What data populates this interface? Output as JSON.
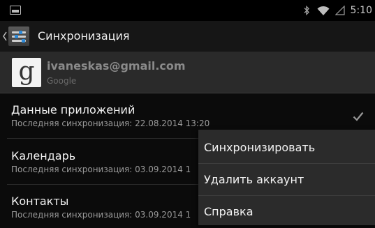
{
  "status_bar": {
    "time": "5:10",
    "icons": [
      "image-icon",
      "bluetooth-icon",
      "wifi-icon",
      "signal-icon"
    ]
  },
  "action_bar": {
    "title": "Синхронизация",
    "icons": [
      "back-caret-icon",
      "settings-sync-icon"
    ]
  },
  "account": {
    "logo_letter": "g",
    "email": "ivaneskas@gmail.com",
    "provider": "Google"
  },
  "sync_items": [
    {
      "title": "Данные приложений",
      "subtitle": "Последняя синхронизация: 22.08.2014 13:20",
      "checked": true
    },
    {
      "title": "Календарь",
      "subtitle": "Последняя синхронизация: 03.09.2014 1"
    },
    {
      "title": "Контакты",
      "subtitle": "Последняя синхронизация: 03.09.2014 1"
    }
  ],
  "menu": {
    "items": [
      "Синхронизировать",
      "Удалить аккаунт",
      "Справка"
    ]
  },
  "colors": {
    "background": "#0b0b0b",
    "status_bar": "#000000",
    "action_bar": "#161616",
    "account_row": "#2a2a2a",
    "menu": "#2b2b2b",
    "accent": "#2d8ad8"
  }
}
